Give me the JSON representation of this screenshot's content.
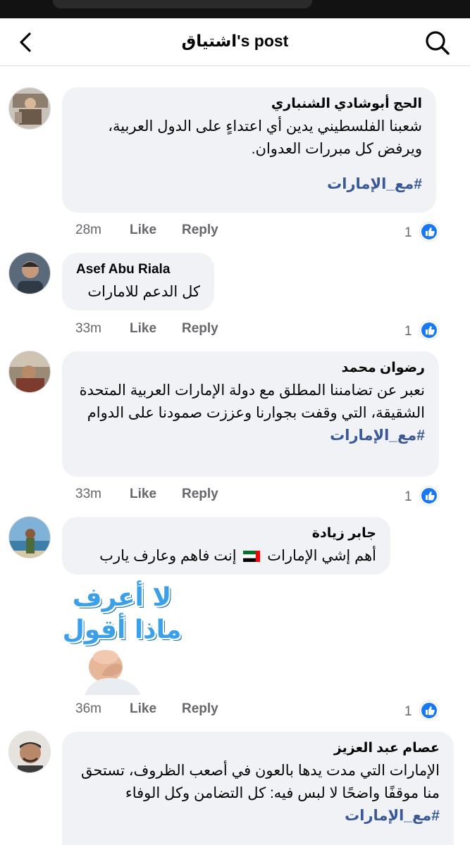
{
  "header": {
    "title": "اشتياق's post"
  },
  "comments": [
    {
      "author": "الحج أبوشادي الشنباري",
      "text": "شعبنا الفلسطيني يدين أي اعتداءٍ على الدول العربية، ويرفض كل مبررات العدوان.",
      "hashtag": "#مع_الإمارات",
      "time": "28m",
      "like": "Like",
      "reply": "Reply",
      "reactions": "1"
    },
    {
      "author": "Asef Abu Riala",
      "text": "كل الدعم للامارات",
      "time": "33m",
      "like": "Like",
      "reply": "Reply",
      "reactions": "1"
    },
    {
      "author": "رضوان محمد",
      "text": "نعبر عن تضامننا المطلق مع دولة الإمارات العربية المتحدة الشقيقة، التي وقفت بجوارنا وعززت صمودنا على الدوام",
      "hashtag": "#مع_الإمارات",
      "time": "33m",
      "like": "Like",
      "reply": "Reply",
      "reactions": "1"
    },
    {
      "author": "جابر زيادة",
      "text_before_flag": "أهم إشي الإمارات",
      "text_after_flag": "إنت فاهم وعارف يارب",
      "flag": "uae-flag-emoji",
      "sticker_line1": "لا أعرف",
      "sticker_line2": "ماذا أقول",
      "time": "36m",
      "like": "Like",
      "reply": "Reply",
      "reactions": "1"
    },
    {
      "author": "عصام عبد العزيز",
      "text": "الإمارات التي مدت يدها بالعون في أصعب الظروف، تستحق منا موقفًا واضحًا لا لبس فيه: كل التضامن وكل الوفاء",
      "hashtag": "#مع_الإمارات"
    }
  ],
  "icons": {
    "back": "chevron-left-icon",
    "search": "search-icon",
    "like_reaction": "thumbs-up-icon"
  },
  "colors": {
    "bubble": "#f0f2f5",
    "hashtag": "#385898",
    "reaction": "#1877f2",
    "meta": "#65676b"
  }
}
